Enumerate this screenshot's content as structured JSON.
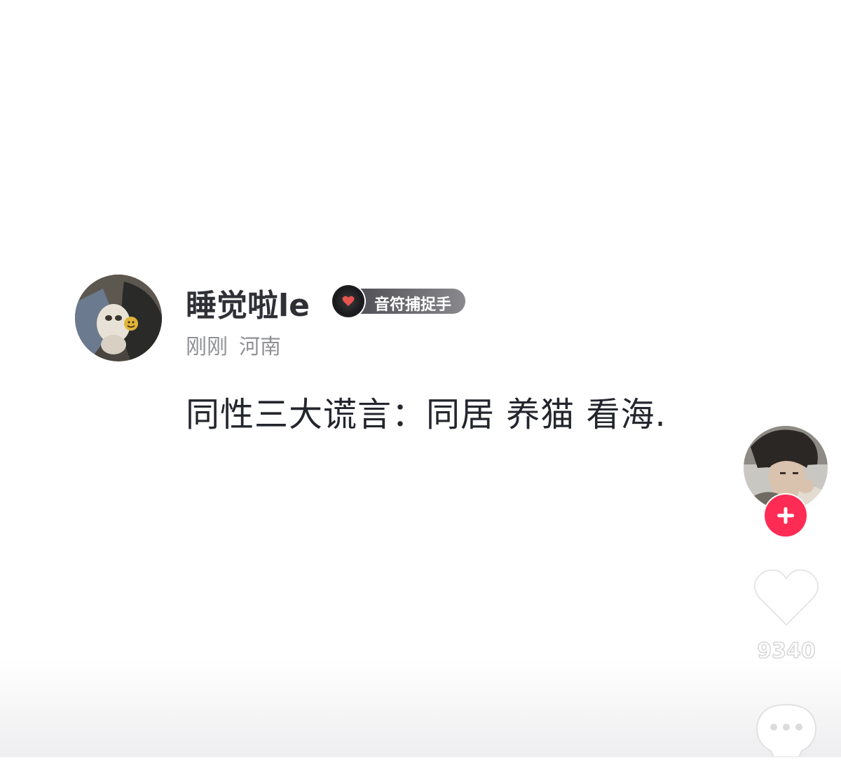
{
  "post": {
    "author_name": "睡觉啦le",
    "badge_label": "音符捕捉手",
    "time": "刚刚",
    "location": "河南",
    "content": "同性三大谎言：同居 养猫 看海."
  },
  "actions": {
    "like_count": "9340"
  },
  "icons": {
    "badge": "music-disc-heart-icon",
    "follow": "plus-icon",
    "like": "heart-icon",
    "more": "more-dots-icon"
  },
  "colors": {
    "follow_button": "#fe2c55",
    "badge_heart": "#e8534f",
    "name_text": "#2f3035",
    "meta_text": "#8f9095",
    "content_text": "#24262e"
  }
}
